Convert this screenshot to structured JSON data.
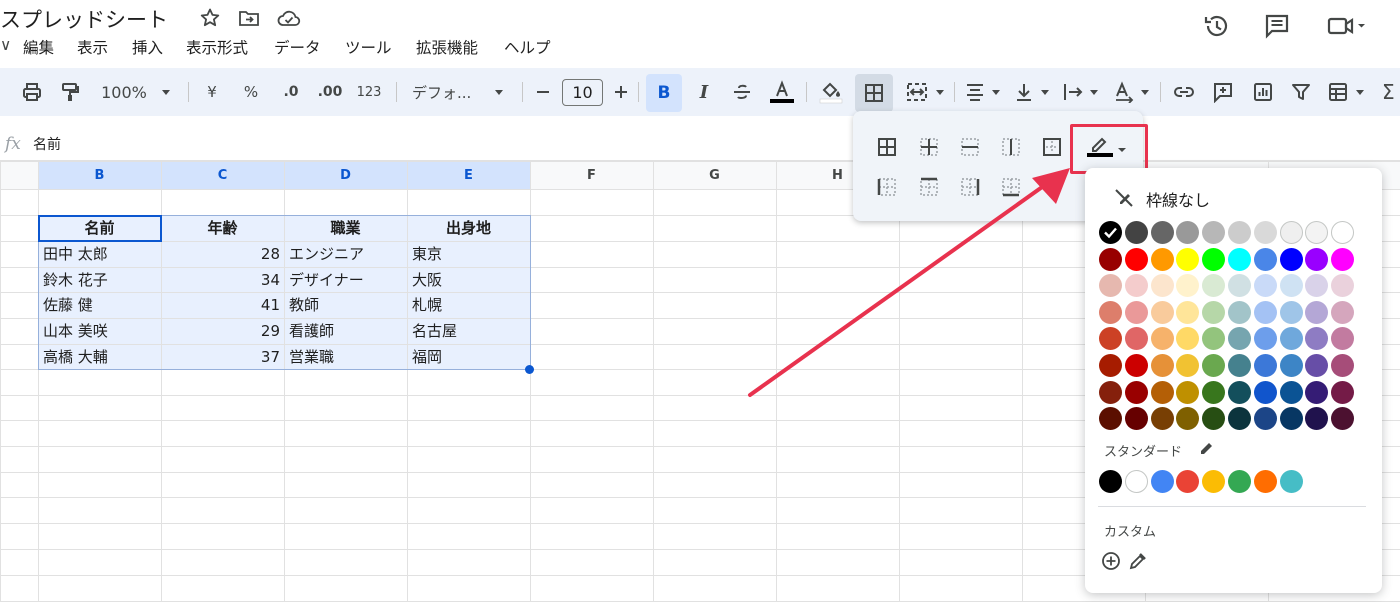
{
  "window": {
    "title": "スプレッドシート"
  },
  "menu": {
    "items": [
      {
        "id": "edit",
        "label": "編集"
      },
      {
        "id": "view",
        "label": "表示"
      },
      {
        "id": "insert",
        "label": "挿入"
      },
      {
        "id": "format",
        "label": "表示形式"
      },
      {
        "id": "data",
        "label": "データ"
      },
      {
        "id": "tools",
        "label": "ツール"
      },
      {
        "id": "extensions",
        "label": "拡張機能"
      },
      {
        "id": "help",
        "label": "ヘルプ"
      }
    ],
    "leading_fragment": "∨"
  },
  "toolbar": {
    "zoom": "100%",
    "currency": "¥",
    "percent": "%",
    "dec_less": ".0",
    "dec_more": ".00",
    "number_format": "123",
    "font": "デフォ...",
    "font_size": "10",
    "bold": "B",
    "italic": "I"
  },
  "formula_bar": {
    "fx": "fx",
    "content": "名前"
  },
  "grid": {
    "columns": [
      "B",
      "C",
      "D",
      "E",
      "F",
      "G",
      "H"
    ],
    "selected_columns": [
      "B",
      "C",
      "D",
      "E"
    ],
    "headers": [
      "名前",
      "年齢",
      "職業",
      "出身地"
    ],
    "rows": [
      [
        "田中 太郎",
        "28",
        "エンジニア",
        "東京"
      ],
      [
        "鈴木 花子",
        "34",
        "デザイナー",
        "大阪"
      ],
      [
        "佐藤 健",
        "41",
        "教師",
        "札幌"
      ],
      [
        "山本 美咲",
        "29",
        "看護師",
        "名古屋"
      ],
      [
        "高橋 大輔",
        "37",
        "営業職",
        "福岡"
      ]
    ]
  },
  "colors": {
    "accent": "#0b57d0",
    "selection": "#e8f0fe",
    "header_selected": "#d3e3fd",
    "highlight_box": "#e8324e",
    "arrow": "#e8324e"
  },
  "palette": {
    "no_border": "枠線なし",
    "standard_label": "スタンダード",
    "custom_label": "カスタム",
    "grid": [
      [
        "#000000",
        "#434343",
        "#666666",
        "#999999",
        "#b7b7b7",
        "#cccccc",
        "#d9d9d9",
        "#efefef",
        "#f3f3f3",
        "#ffffff"
      ],
      [
        "#980000",
        "#ff0000",
        "#ff9900",
        "#ffff00",
        "#00ff00",
        "#00ffff",
        "#4a86e8",
        "#0000ff",
        "#9900ff",
        "#ff00ff"
      ],
      [
        "#e6b8af",
        "#f4cccc",
        "#fce5cd",
        "#fff2cc",
        "#d9ead3",
        "#d0e0e3",
        "#c9daf8",
        "#cfe2f3",
        "#d9d2e9",
        "#ead1dc"
      ],
      [
        "#dd7e6b",
        "#ea9999",
        "#f9cb9c",
        "#ffe599",
        "#b6d7a8",
        "#a2c4c9",
        "#a4c2f4",
        "#9fc5e8",
        "#b4a7d6",
        "#d5a6bd"
      ],
      [
        "#cc4125",
        "#e06666",
        "#f6b26b",
        "#ffd966",
        "#93c47d",
        "#76a5af",
        "#6d9eeb",
        "#6fa8dc",
        "#8e7cc3",
        "#c27ba0"
      ],
      [
        "#a61c00",
        "#cc0000",
        "#e69138",
        "#f1c232",
        "#6aa84f",
        "#45818e",
        "#3c78d8",
        "#3d85c6",
        "#674ea7",
        "#a64d79"
      ],
      [
        "#85200c",
        "#990000",
        "#b45f06",
        "#bf9000",
        "#38761d",
        "#134f5c",
        "#1155cc",
        "#0b5394",
        "#351c75",
        "#741b47"
      ],
      [
        "#5b0f00",
        "#660000",
        "#783f04",
        "#7f6000",
        "#274e13",
        "#0c343d",
        "#1c4587",
        "#073763",
        "#20124d",
        "#4c1130"
      ]
    ],
    "standard": [
      "#000000",
      "#ffffff",
      "#4285f4",
      "#ea4335",
      "#fbbc04",
      "#34a853",
      "#ff6d01",
      "#46bdc6"
    ],
    "selected_index": [
      0,
      0
    ]
  }
}
